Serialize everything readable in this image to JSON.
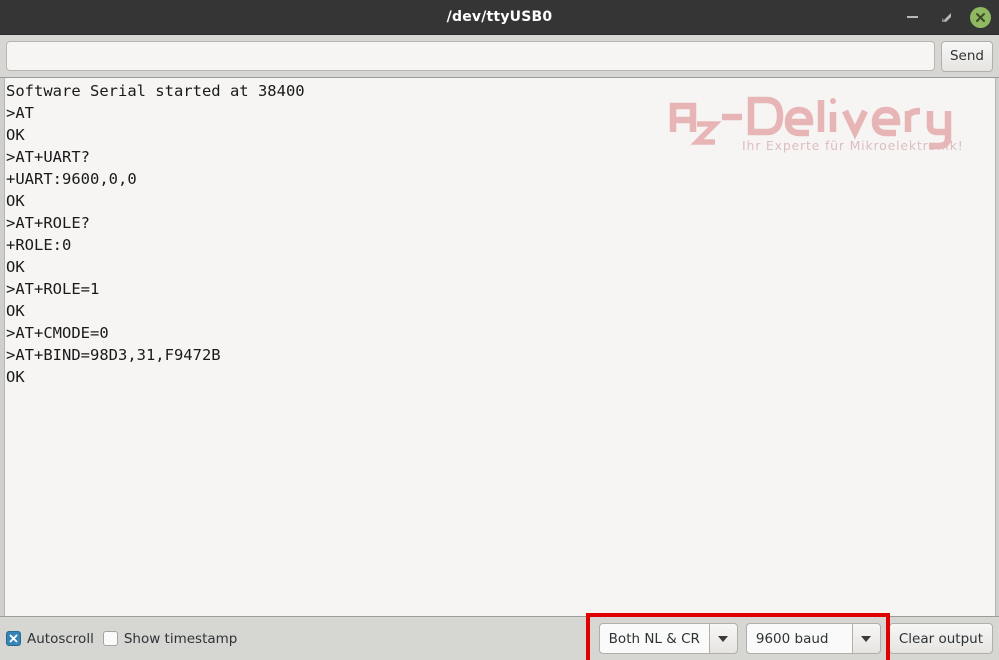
{
  "window": {
    "title": "/dev/ttyUSB0",
    "controls": {
      "minimize": "minimize-icon",
      "maximize": "maximize-icon",
      "close": "close-icon"
    }
  },
  "send_bar": {
    "input_value": "",
    "input_placeholder": "",
    "send_label": "Send"
  },
  "console": {
    "lines": [
      "Software Serial started at 38400",
      ">AT",
      "OK",
      ">AT+UART?",
      "+UART:9600,0,0",
      "OK",
      ">AT+ROLE?",
      "+ROLE:0",
      "OK",
      ">AT+ROLE=1",
      "OK",
      ">AT+CMODE=0",
      ">AT+BIND=98D3,31,F9472B",
      "OK"
    ]
  },
  "watermark": {
    "brand": "AZ-Delivery",
    "tagline": "Ihr Experte für Mikroelektronik!",
    "color": "#e08f93"
  },
  "toolbar": {
    "autoscroll": {
      "label": "Autoscroll",
      "checked": true
    },
    "show_timestamp": {
      "label": "Show timestamp",
      "checked": false
    },
    "line_ending": {
      "selected": "Both NL & CR"
    },
    "baud_rate": {
      "selected": "9600 baud"
    },
    "clear_label": "Clear output"
  },
  "annotation": {
    "highlight_color": "#e00000"
  }
}
